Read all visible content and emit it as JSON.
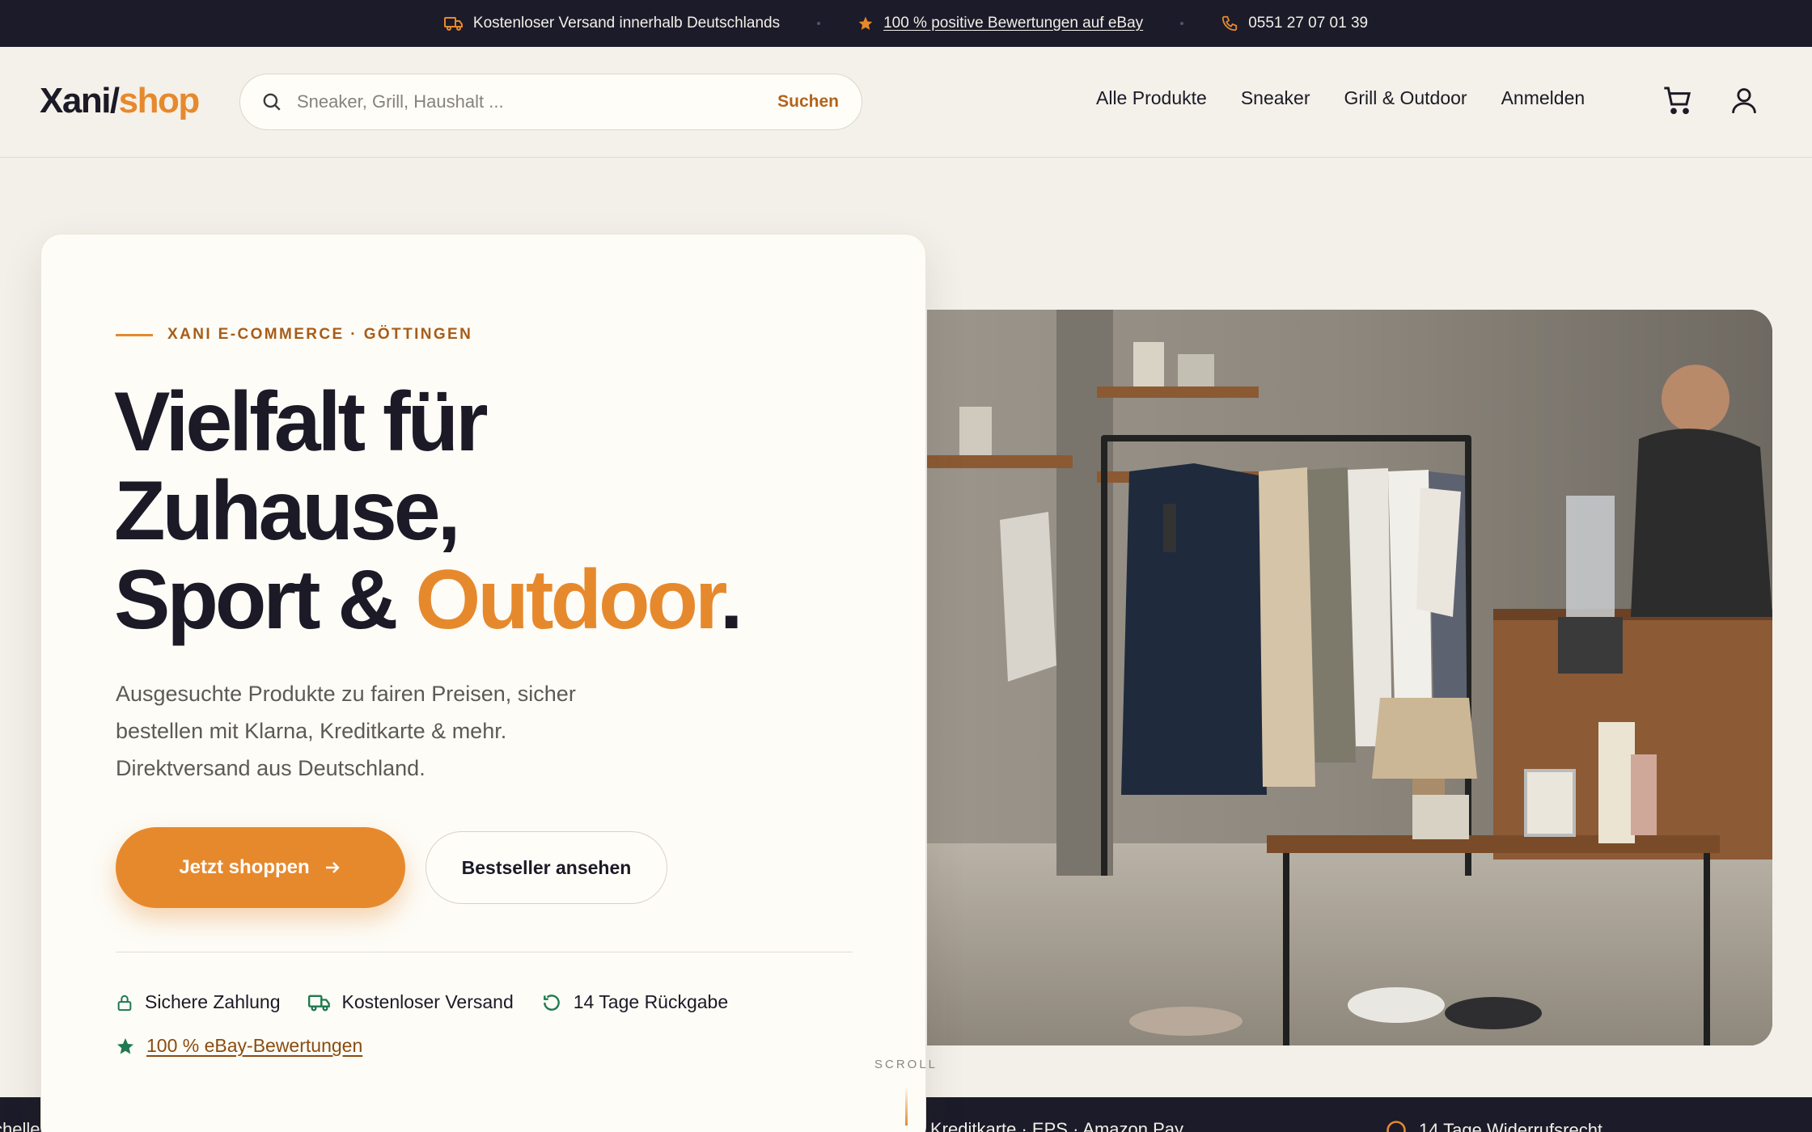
{
  "topbar": {
    "shipping": "Kostenloser Versand innerhalb Deutschlands",
    "reviews": "100 % positive Bewertungen auf eBay",
    "phone": "0551 27 07 01 39"
  },
  "header": {
    "logo_part1": "Xani/",
    "logo_part2": "shop",
    "search_placeholder": "Sneaker, Grill, Haushalt ...",
    "search_button": "Suchen",
    "nav": [
      "Alle Produkte",
      "Sneaker",
      "Grill & Outdoor",
      "Anmelden"
    ]
  },
  "hero": {
    "eyebrow": "XANI E-COMMERCE · GÖTTINGEN",
    "headline_line1": "Vielfalt für",
    "headline_line2": "Zuhause,",
    "headline_line3_a": "Sport & ",
    "headline_line3_b": "Outdoor",
    "headline_line3_c": ".",
    "subtext": "Ausgesuchte Produkte zu fairen Preisen, sicher bestellen mit Klarna, Kreditkarte & mehr. Direktversand aus Deutschland.",
    "primary_button": "Jetzt shoppen",
    "secondary_button": "Bestseller ansehen",
    "trust": [
      "Sichere Zahlung",
      "Kostenloser Versand",
      "14 Tage Rückgabe"
    ],
    "ebay_link": "100 % eBay-Bewertungen",
    "scroll_label": "SCROLL"
  },
  "bottom_strip": {
    "left": "chelle",
    "middle": "Kreditkarte · EPS · Amazon Pay",
    "right": "14 Tage Widerrufsrecht"
  },
  "colors": {
    "accent": "#e6892d",
    "dark": "#1c1b29",
    "background": "#f3f0e9",
    "trust_green": "#1f7a4f"
  }
}
